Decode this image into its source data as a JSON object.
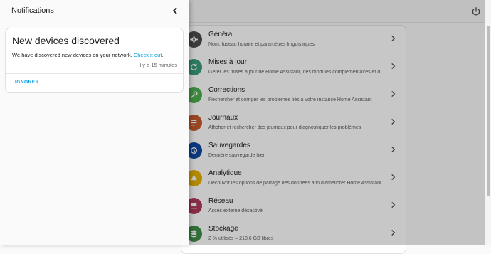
{
  "drawer": {
    "title": "Notifications",
    "notification": {
      "title": "New devices discovered",
      "message": "We have discovered new devices on your network.",
      "link_text": "Check it out",
      "link_suffix": ".",
      "time": "Il y a 15 minutes",
      "dismiss_label": "IGNORER"
    }
  },
  "settings": {
    "items": [
      {
        "title": "Général",
        "description": "Nom, fuseau horaire et paramètres linguistiques",
        "icon": "gear-icon",
        "color": "#4e4e4e"
      },
      {
        "title": "Mises à jour",
        "description": "Gérer les mises à jour de Home Assistant, des modules complémentaires et des appareils",
        "icon": "update-icon",
        "color": "#3a9b7c"
      },
      {
        "title": "Corrections",
        "description": "Rechercher et corriger les problèmes liés à votre instance Home Assistant",
        "icon": "wrench-icon",
        "color": "#4caf50"
      },
      {
        "title": "Journaux",
        "description": "Afficher et rechercher des journaux pour diagnostiquer les problèmes",
        "icon": "log-icon",
        "color": "#c55a2c"
      },
      {
        "title": "Sauvegardes",
        "description": "Dernière sauvegarde hier",
        "icon": "backup-icon",
        "color": "#0d47a1"
      },
      {
        "title": "Analytique",
        "description": "Découvrir les options de partage des données afin d'améliorer Home Assistant",
        "icon": "analytics-icon",
        "color": "#e5b000"
      },
      {
        "title": "Réseau",
        "description": "Accès externe désactivé",
        "icon": "network-icon",
        "color": "#b03a5a"
      },
      {
        "title": "Stockage",
        "description": "2 % utilisés – 218.6 GB libres",
        "icon": "storage-icon",
        "color": "#3f8f4a"
      }
    ]
  }
}
